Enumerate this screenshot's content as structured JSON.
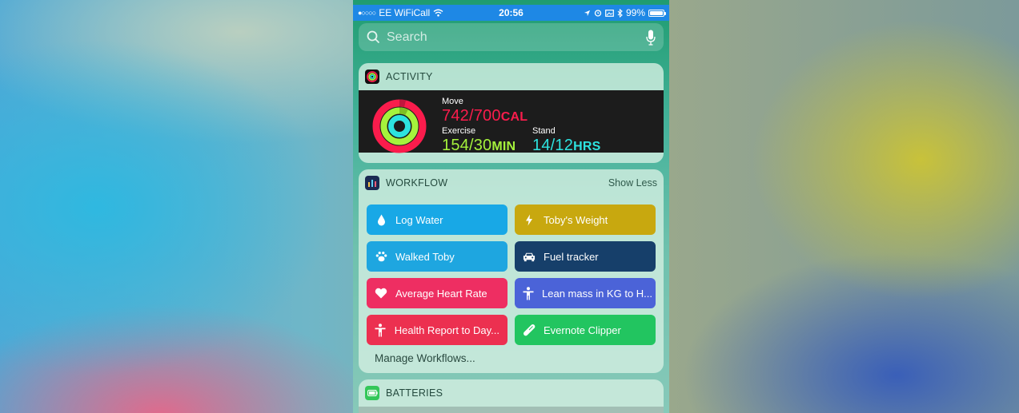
{
  "status_bar": {
    "carrier": "EE WiFiCall",
    "time": "20:56",
    "battery": "99%"
  },
  "search": {
    "placeholder": "Search"
  },
  "activity": {
    "header": "ACTIVITY",
    "move_label": "Move",
    "move_value": "742/700",
    "move_unit": "CAL",
    "exercise_label": "Exercise",
    "exercise_value": "154/30",
    "exercise_unit": "MIN",
    "stand_label": "Stand",
    "stand_value": "14/12",
    "stand_unit": "HRS",
    "colors": {
      "move": "#fa1c4c",
      "exercise": "#a5f23c",
      "stand": "#2de3e0"
    }
  },
  "workflow": {
    "header": "WORKFLOW",
    "show_less": "Show Less",
    "manage": "Manage Workflows...",
    "buttons": [
      {
        "label": "Log Water",
        "icon": "water-drop-icon",
        "color": "#18a8e6"
      },
      {
        "label": "Toby's Weight",
        "icon": "lightning-icon",
        "color": "#c8a80f"
      },
      {
        "label": "Walked Toby",
        "icon": "paw-icon",
        "color": "#1ea6e0"
      },
      {
        "label": "Fuel tracker",
        "icon": "car-icon",
        "color": "#163f6a"
      },
      {
        "label": "Average Heart Rate",
        "icon": "heart-icon",
        "color": "#ee2e62"
      },
      {
        "label": "Lean mass in KG to H...",
        "icon": "person-icon",
        "color": "#4b63d8"
      },
      {
        "label": "Health Report to Day...",
        "icon": "person-icon",
        "color": "#ec3050"
      },
      {
        "label": "Evernote Clipper",
        "icon": "pill-icon",
        "color": "#22c560"
      }
    ]
  },
  "batteries": {
    "header": "BATTERIES"
  }
}
